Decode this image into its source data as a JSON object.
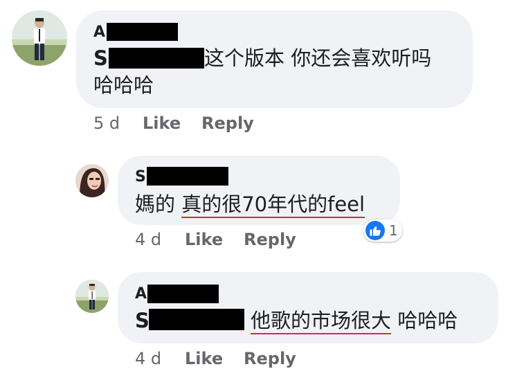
{
  "comments": [
    {
      "name_initial": "A",
      "text_prefix": "S",
      "text_line1": "这个版本 你还会喜欢听吗",
      "text_line2": "哈哈哈",
      "time": "5 d",
      "like_label": "Like",
      "reply_label": "Reply"
    }
  ],
  "replies": [
    {
      "name_initial": "S",
      "text_lead": "媽的 ",
      "text_underlined": "真的很70年代的feel",
      "time": "4 d",
      "like_label": "Like",
      "reply_label": "Reply",
      "reaction_icon": "thumbs-up-icon",
      "reaction_count": "1"
    },
    {
      "name_initial": "A",
      "text_prefix": "S",
      "text_underlined": "他歌的市场很大",
      "text_tail": " 哈哈哈",
      "time": "4 d",
      "like_label": "Like",
      "reply_label": "Reply"
    }
  ],
  "colors": {
    "bubble": "#f0f2f5",
    "meta": "#65676b",
    "underline": "#d0312d",
    "like_blue": "#1877f2"
  }
}
